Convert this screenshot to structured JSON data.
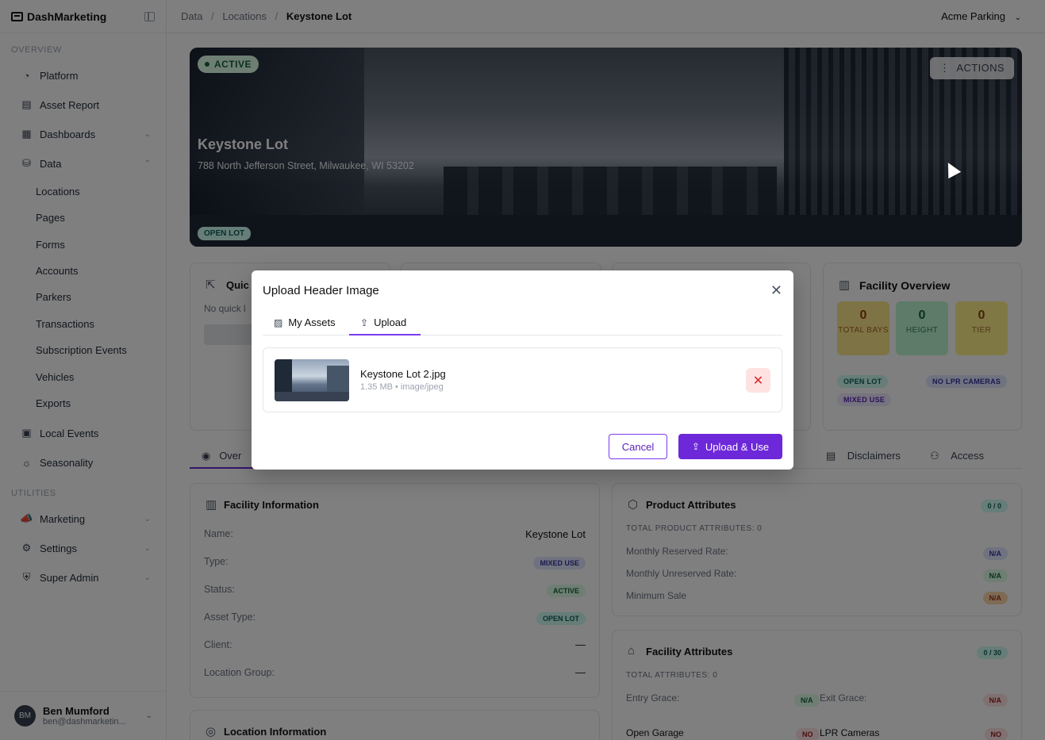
{
  "app": {
    "name": "DashMarketing"
  },
  "sidebar": {
    "sections": {
      "overview": "OVERVIEW",
      "utilities": "UTILITIES"
    },
    "items": {
      "platform": "Platform",
      "asset_report": "Asset Report",
      "dashboards": "Dashboards",
      "data": "Data",
      "local_events": "Local Events",
      "seasonality": "Seasonality",
      "marketing": "Marketing",
      "settings": "Settings",
      "super_admin": "Super Admin"
    },
    "data_sub": [
      "Locations",
      "Pages",
      "Forms",
      "Accounts",
      "Parkers",
      "Transactions",
      "Subscription Events",
      "Vehicles",
      "Exports"
    ],
    "user": {
      "initials": "BM",
      "name": "Ben Mumford",
      "email": "ben@dashmarketin..."
    }
  },
  "topbar": {
    "breadcrumb": [
      "Data",
      "Locations",
      "Keystone Lot"
    ],
    "separator": "/",
    "org": "Acme Parking"
  },
  "hero": {
    "status": "ACTIVE",
    "actions": "ACTIONS",
    "title": "Keystone Lot",
    "address": "788 North Jefferson Street, Milwaukee, WI 53202",
    "lot_badge": "OPEN LOT"
  },
  "cards": {
    "quick": {
      "title": "Quic",
      "text": "No quick l"
    },
    "facility_overview": {
      "title": "Facility Overview",
      "stats": [
        {
          "value": "0",
          "label": "TOTAL BAYS"
        },
        {
          "value": "0",
          "label": "HEIGHT"
        },
        {
          "value": "0",
          "label": "TIER"
        }
      ],
      "pills": [
        "OPEN LOT",
        "NO LPR CAMERAS",
        "MIXED USE"
      ]
    }
  },
  "tabs": {
    "overview": "Over",
    "disclaimers": "Disclaimers",
    "access": "Access"
  },
  "facility_info": {
    "title": "Facility Information",
    "rows": [
      {
        "label": "Name:",
        "value": "Keystone Lot"
      },
      {
        "label": "Type:",
        "value": "MIXED USE"
      },
      {
        "label": "Status:",
        "value": "ACTIVE"
      },
      {
        "label": "Asset Type:",
        "value": "OPEN LOT"
      },
      {
        "label": "Client:",
        "value": "—"
      },
      {
        "label": "Location Group:",
        "value": "—"
      }
    ]
  },
  "location_info": {
    "title": "Location Information"
  },
  "product_attrs": {
    "title": "Product Attributes",
    "count": "0 / 0",
    "total": "TOTAL PRODUCT ATTRIBUTES: 0",
    "rows": [
      {
        "label": "Monthly Reserved Rate:",
        "value": "N/A"
      },
      {
        "label": "Monthly Unreserved Rate:",
        "value": "N/A"
      },
      {
        "label": "Minimum Sale",
        "value": "N/A"
      }
    ]
  },
  "facility_attrs": {
    "title": "Facility Attributes",
    "count": "0 / 30",
    "total": "TOTAL ATTRIBUTES: 0",
    "rows": [
      {
        "label": "Entry Grace:",
        "value": "N/A"
      },
      {
        "label": "Exit Grace:",
        "value": "N/A"
      },
      {
        "label": "Open Garage",
        "value": "NO"
      },
      {
        "label": "LPR Cameras",
        "value": "NO"
      }
    ]
  },
  "modal": {
    "title": "Upload Header Image",
    "tabs": {
      "my_assets": "My Assets",
      "upload": "Upload"
    },
    "file": {
      "name": "Keystone Lot 2.jpg",
      "meta": "1.35 MB • image/jpeg"
    },
    "cancel": "Cancel",
    "submit": "Upload & Use"
  }
}
